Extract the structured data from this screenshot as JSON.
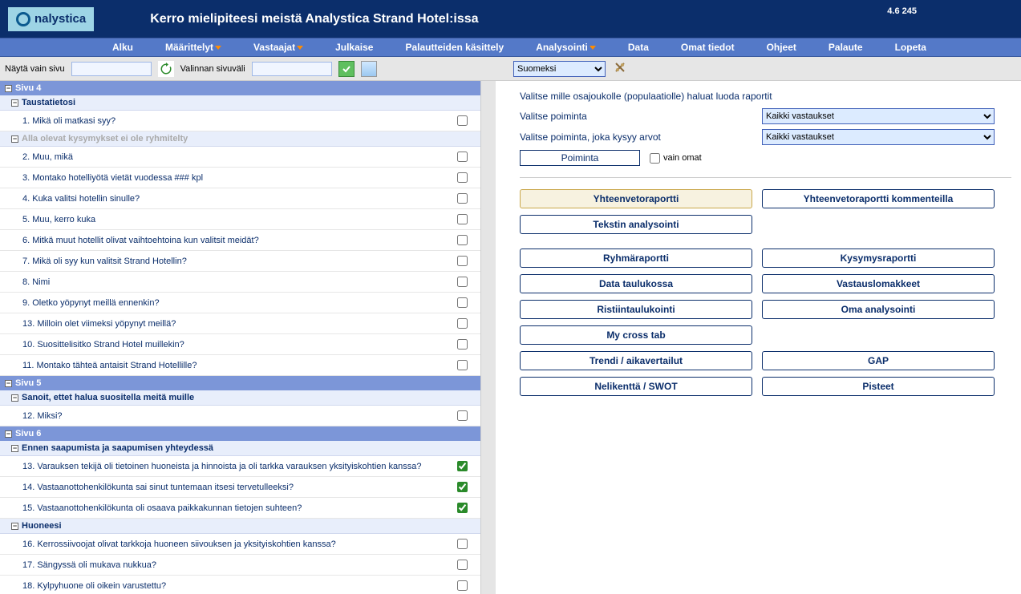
{
  "header": {
    "logo_text": "nalystica",
    "title": "Kerro mielipiteesi meistä Analystica Strand Hotel:issa",
    "version": "4.6 245"
  },
  "menubar": [
    {
      "label": "Alku",
      "arrow": false
    },
    {
      "label": "Määrittelyt",
      "arrow": true
    },
    {
      "label": "Vastaajat",
      "arrow": true
    },
    {
      "label": "Julkaise",
      "arrow": false
    },
    {
      "label": "Palautteiden käsittely",
      "arrow": false
    },
    {
      "label": "Analysointi",
      "arrow": true
    },
    {
      "label": "Data",
      "arrow": false
    },
    {
      "label": "Omat tiedot",
      "arrow": false
    },
    {
      "label": "Ohjeet",
      "arrow": false
    },
    {
      "label": "Palaute",
      "arrow": false
    },
    {
      "label": "Lopeta",
      "arrow": false
    }
  ],
  "toolbar": {
    "show_only_page_label": "Näytä vain sivu",
    "selection_range_label": "Valinnan sivuväli",
    "language_selected": "Suomeksi"
  },
  "left_panel": {
    "pages": [
      {
        "title": "Sivu 4",
        "groups": [
          {
            "title": "Taustatietosi",
            "muted": false,
            "questions": [
              {
                "text": "1. Mikä oli matkasi syy?",
                "checked": false
              }
            ]
          },
          {
            "title": "Alla olevat kysymykset ei ole ryhmitelty",
            "muted": true,
            "questions": [
              {
                "text": "2. Muu, mikä",
                "checked": false
              },
              {
                "text": "3. Montako hotelliyötä vietät vuodessa ### kpl",
                "checked": false
              },
              {
                "text": "4. Kuka valitsi hotellin sinulle?",
                "checked": false
              },
              {
                "text": "5. Muu, kerro kuka",
                "checked": false
              },
              {
                "text": "6. Mitkä muut hotellit olivat vaihtoehtoina kun valitsit meidät?",
                "checked": false
              },
              {
                "text": "7. Mikä oli syy kun valitsit Strand Hotellin?",
                "checked": false
              },
              {
                "text": "8. Nimi",
                "checked": false
              },
              {
                "text": "9. Oletko yöpynyt meillä ennenkin?",
                "checked": false
              },
              {
                "text": "13. Milloin olet viimeksi yöpynyt meillä?",
                "checked": false
              },
              {
                "text": "10. Suosittelisitko Strand Hotel muillekin?",
                "checked": false
              },
              {
                "text": "11. Montako tähteä antaisit Strand Hotellille?",
                "checked": false
              }
            ]
          }
        ]
      },
      {
        "title": "Sivu 5",
        "groups": [
          {
            "title": "Sanoit, ettet halua suositella meitä muille",
            "muted": false,
            "questions": [
              {
                "text": "12. Miksi?",
                "checked": false
              }
            ]
          }
        ]
      },
      {
        "title": "Sivu 6",
        "groups": [
          {
            "title": "Ennen saapumista ja saapumisen yhteydessä",
            "muted": false,
            "questions": [
              {
                "text": "13. Varauksen tekijä oli tietoinen huoneista ja hinnoista ja oli tarkka varauksen yksityiskohtien kanssa?",
                "checked": true
              },
              {
                "text": "14. Vastaanottohenkilökunta sai sinut tuntemaan itsesi tervetulleeksi?",
                "checked": true
              },
              {
                "text": "15. Vastaanottohenkilökunta oli osaava paikkakunnan tietojen suhteen?",
                "checked": true
              }
            ]
          },
          {
            "title": "Huoneesi",
            "muted": false,
            "questions": [
              {
                "text": "16. Kerrossiivoojat olivat tarkkoja huoneen siivouksen ja yksityiskohtien kanssa?",
                "checked": false
              },
              {
                "text": "17. Sängyssä oli mukava nukkua?",
                "checked": false
              },
              {
                "text": "18. Kylpyhuone oli oikein varustettu?",
                "checked": false
              }
            ]
          }
        ]
      }
    ]
  },
  "right_panel": {
    "intro": "Valitse mille osajoukolle (populaatiolle) haluat luoda raportit",
    "select_poiminta_label": "Valitse poiminta",
    "select_poiminta_ask_label": "Valitse poiminta, joka kysyy arvot",
    "all_answers_option": "Kaikki vastaukset",
    "poiminta_btn": "Poiminta",
    "vain_omat_label": "vain omat",
    "buttons_top": [
      {
        "label": "Yhteenvetoraportti",
        "highlight": true
      },
      {
        "label": "Yhteenvetoraportti kommenteilla",
        "highlight": false
      },
      {
        "label": "Tekstin analysointi",
        "highlight": false
      }
    ],
    "buttons_grid": [
      "Ryhmäraportti",
      "Kysymysraportti",
      "Data taulukossa",
      "Vastauslomakkeet",
      "Ristiintaulukointi",
      "Oma analysointi",
      "My cross tab",
      "",
      "Trendi / aikavertailut",
      "GAP",
      "Nelikenttä / SWOT",
      "Pisteet"
    ]
  }
}
